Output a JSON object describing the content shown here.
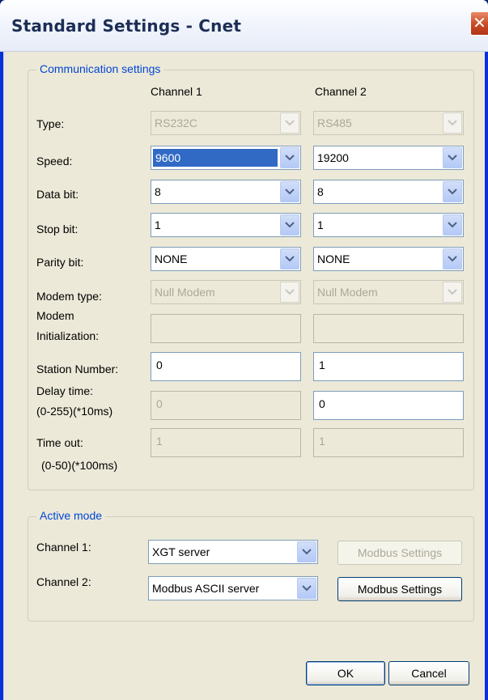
{
  "window": {
    "title": "Standard Settings - Cnet",
    "close_label": "✕"
  },
  "comm": {
    "legend": "Communication settings",
    "channel1_header": "Channel 1",
    "channel2_header": "Channel 2",
    "labels": {
      "type": "Type:",
      "speed": "Speed:",
      "data_bit": "Data bit:",
      "stop_bit": "Stop bit:",
      "parity_bit": "Parity bit:",
      "modem_type": "Modem type:",
      "modem_init_1": "Modem",
      "modem_init_2": "Initialization:",
      "station_number": "Station Number:",
      "delay_time_1": "Delay time:",
      "delay_time_2": "(0-255)(*10ms)",
      "time_out_1": "Time out:",
      "time_out_2": "(0-50)(*100ms)"
    },
    "ch1": {
      "type": "RS232C",
      "speed": "9600",
      "data_bit": "8",
      "stop_bit": "1",
      "parity_bit": "NONE",
      "modem_type": "Null Modem",
      "modem_init": "",
      "station_number": "0",
      "delay_time": "0",
      "time_out": "1"
    },
    "ch2": {
      "type": "RS485",
      "speed": "19200",
      "data_bit": "8",
      "stop_bit": "1",
      "parity_bit": "NONE",
      "modem_type": "Null Modem",
      "modem_init": "",
      "station_number": "1",
      "delay_time": "0",
      "time_out": "1"
    }
  },
  "active": {
    "legend": "Active mode",
    "ch1_label": "Channel 1:",
    "ch2_label": "Channel 2:",
    "ch1_mode": "XGT server",
    "ch2_mode": "Modbus ASCII server",
    "modbus_settings_label": "Modbus Settings"
  },
  "buttons": {
    "ok": "OK",
    "cancel": "Cancel"
  },
  "colors": {
    "accent": "#0046d5",
    "selection": "#316ac5",
    "face": "#ece9d8"
  }
}
